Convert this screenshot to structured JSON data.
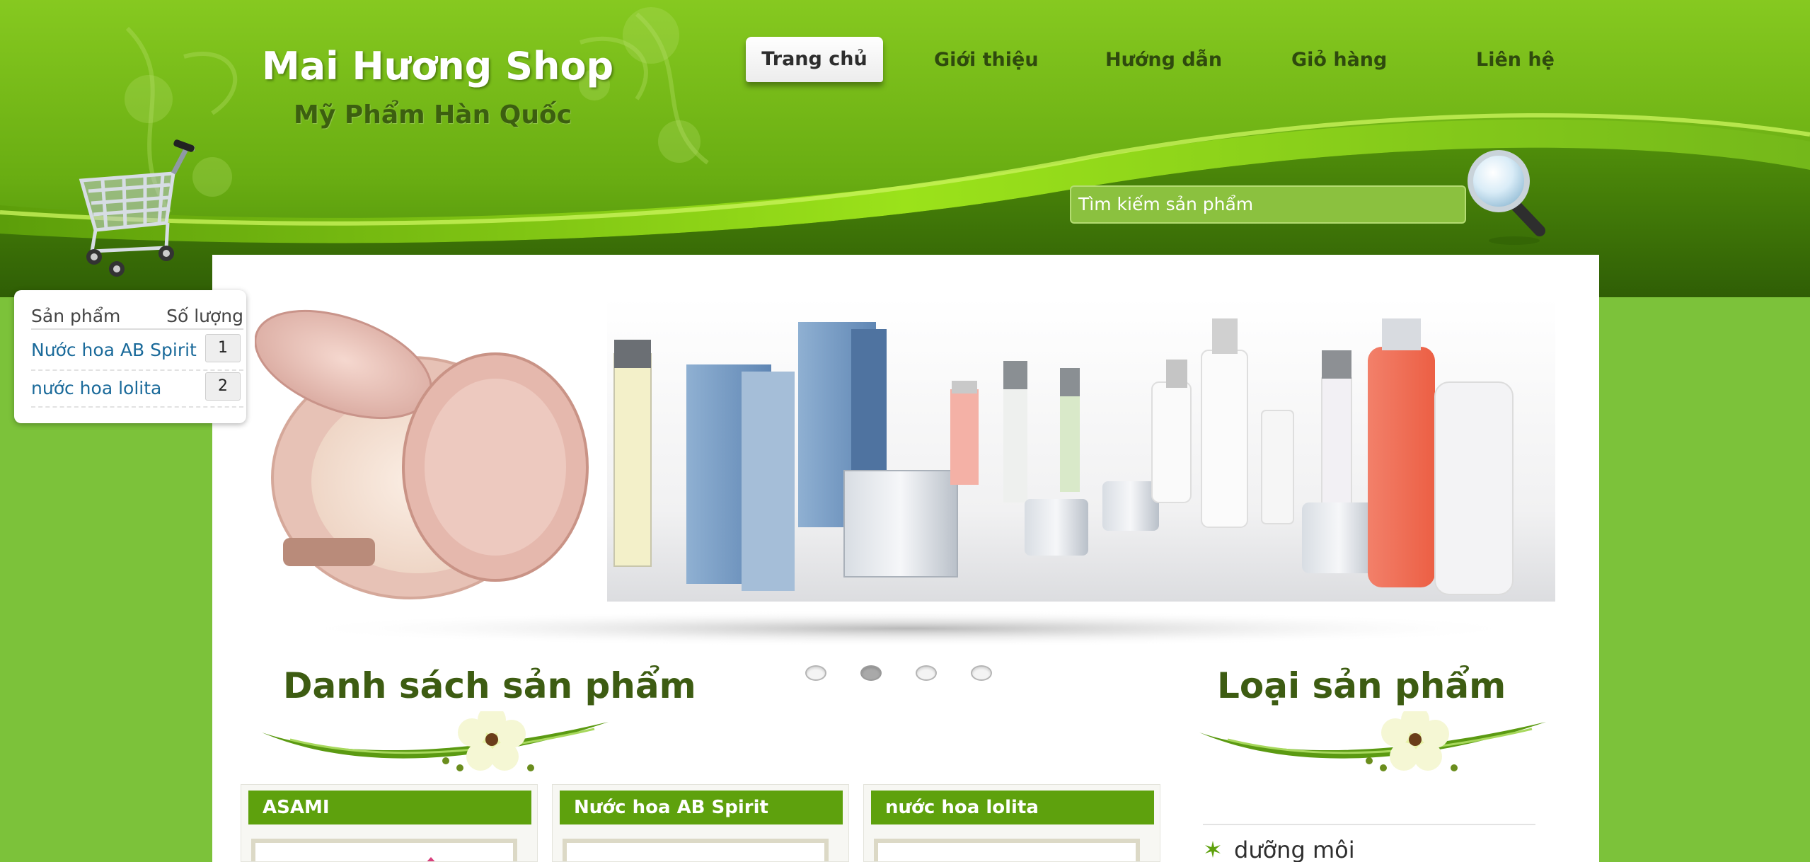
{
  "brand": {
    "title": "Mai Hương Shop",
    "subtitle": "Mỹ Phẩm Hàn Quốc"
  },
  "nav": {
    "items": [
      {
        "label": "Trang chủ",
        "active": true
      },
      {
        "label": "Giới thiệu"
      },
      {
        "label": "Hướng dẫn"
      },
      {
        "label": "Giỏ hàng"
      },
      {
        "label": "Liên hệ"
      }
    ]
  },
  "search": {
    "placeholder": "Tìm kiếm sản phẩm",
    "button_icon": "magnifier-icon"
  },
  "cart": {
    "header_product": "Sản phẩm",
    "header_qty": "Số lượng",
    "items": [
      {
        "name": "Nước hoa AB Spirit",
        "qty": "1"
      },
      {
        "name": "nước hoa lolita",
        "qty": "2"
      }
    ]
  },
  "slider": {
    "active_index": 1,
    "count": 4
  },
  "products_section": {
    "title": "Danh sách sản phẩm",
    "items": [
      {
        "name": "ASAMI"
      },
      {
        "name": "Nước hoa AB Spirit"
      },
      {
        "name": "nước hoa lolita"
      }
    ]
  },
  "categories_section": {
    "title": "Loại sản phẩm",
    "items": [
      {
        "name": "dưỡng môi"
      }
    ]
  },
  "colors": {
    "primary_green": "#7cc23a",
    "header_dark_green": "#4e8a10",
    "product_head_green": "#5ea10d",
    "title_green": "#3d5c12",
    "link_blue": "#1a6a9a"
  }
}
